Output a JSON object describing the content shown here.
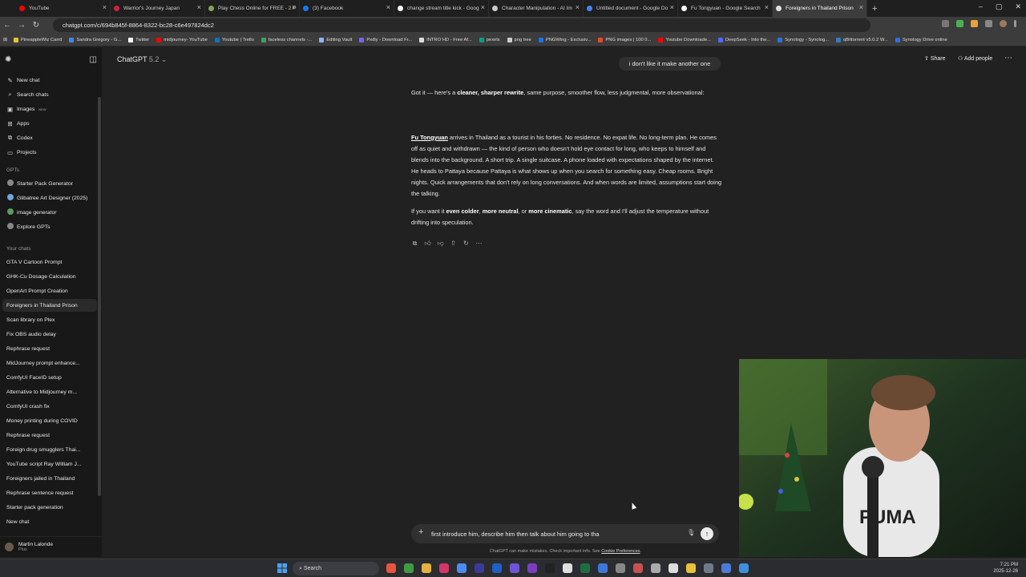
{
  "browser": {
    "tabs": [
      {
        "title": "YouTube",
        "color": "#ff0000",
        "active": false
      },
      {
        "title": "Warrior's Journey Japan",
        "color": "#d21f3c",
        "active": false
      },
      {
        "title": "Play Chess Online for FREE - 2 P",
        "color": "#7fa650",
        "active": false
      },
      {
        "title": "(3) Facebook",
        "color": "#1877f2",
        "active": false
      },
      {
        "title": "change stream title kick - Goog",
        "color": "#ffffff",
        "active": false
      },
      {
        "title": "Character Manipulation - AI Im",
        "color": "#cccccc",
        "active": false
      },
      {
        "title": "Untitled document - Google Do",
        "color": "#4285f4",
        "active": false
      },
      {
        "title": "Fu Tongyuan - Google Search",
        "color": "#ffffff",
        "active": false
      },
      {
        "title": "Foreigners in Thailand Prison",
        "color": "#e0e0e0",
        "active": true
      }
    ],
    "url": "chatgpt.com/c/694b845f-8864-8322-bc28-c6e497824dc2",
    "bookmarks": [
      {
        "label": "PineappleWiz Carrd",
        "color": "#e6c13a"
      },
      {
        "label": "Sandra Gregory - G...",
        "color": "#4285f4"
      },
      {
        "label": "Twitter",
        "color": "#ffffff"
      },
      {
        "label": "midjourney- YouTube",
        "color": "#ff0000"
      },
      {
        "label": "Youtube | Trello",
        "color": "#0079bf"
      },
      {
        "label": "faceless channels -...",
        "color": "#34a853"
      },
      {
        "label": "Editing Vault",
        "color": "#8ab4f8"
      },
      {
        "label": "Pxdly - Download Fr...",
        "color": "#7b61ff"
      },
      {
        "label": "INTRO HD - Free Af...",
        "color": "#dddddd"
      },
      {
        "label": "pexels",
        "color": "#05a081"
      },
      {
        "label": "png tree",
        "color": "#cccccc"
      },
      {
        "label": "PNGWing - Exclusiv...",
        "color": "#1a73e8"
      },
      {
        "label": "PNG images | 100 0...",
        "color": "#e34c26"
      },
      {
        "label": "Youtube Downloade...",
        "color": "#ff0000"
      },
      {
        "label": "DeepSeek - Into the...",
        "color": "#4d6bfe"
      },
      {
        "label": "Synology - Synolog...",
        "color": "#2f6fe0"
      },
      {
        "label": "qBittorrent v5.0.2 W...",
        "color": "#3a79c1"
      },
      {
        "label": "Synology Drive online",
        "color": "#2f6fe0"
      }
    ]
  },
  "sidebar": {
    "primary": [
      {
        "label": "New chat",
        "icon": "✎",
        "iconName": "new-chat-icon"
      },
      {
        "label": "Search chats",
        "icon": "⌕",
        "iconName": "search-icon"
      },
      {
        "label": "Images",
        "icon": "▣",
        "iconName": "images-icon",
        "badge": "NEW"
      },
      {
        "label": "Apps",
        "icon": "⊞",
        "iconName": "apps-icon"
      },
      {
        "label": "Codex",
        "icon": "⧉",
        "iconName": "codex-icon"
      },
      {
        "label": "Projects",
        "icon": "▭",
        "iconName": "projects-icon"
      }
    ],
    "gpts_heading": "GPTs",
    "gpts": [
      {
        "label": "Starter Pack Generator",
        "color": "#8a8a8a"
      },
      {
        "label": "Glibatree Art Designer (2025)",
        "color": "#6fa8dc"
      },
      {
        "label": "image generator",
        "color": "#5c9a5c"
      },
      {
        "label": "Explore GPTs",
        "color": "#888888"
      }
    ],
    "chats_heading": "Your chats",
    "chats": [
      "GTA V Cartoon Prompt",
      "GHK-Cu Dosage Calculation",
      "OpenArt Prompt Creation",
      "Foreigners in Thailand Prison",
      "Scan library on Plex",
      "Fix OBS audio delay",
      "Rephrase request",
      "MidJourney prompt enhance...",
      "ComfyUI FaceID setup",
      "Alternative to Midjourney m...",
      "ComfyUI crash fix",
      "Money printing during COVID",
      "Rephrase request",
      "Foreign drug smugglers Thai...",
      "YouTube script Ray William J...",
      "Foreigners jailed in Thailand",
      "Rephrase sentence request",
      "Starter pack generation",
      "New chat"
    ],
    "active_chat_index": 3,
    "user": {
      "name": "Martin Lalonde",
      "plan": "Plus"
    }
  },
  "header": {
    "model": "ChatGPT",
    "version": "5.2",
    "share": "Share",
    "add_people": "Add people"
  },
  "conversation": {
    "user_message": "i don't like it make another one",
    "p1": {
      "before": "Got it — here's a ",
      "bold": "cleaner, sharper rewrite",
      "after": ", same purpose, smoother flow, less judgmental, more observational:"
    },
    "p2": {
      "name": "Fu Tongyuan",
      "text": " arrives in Thailand as a tourist in his forties. No residence. No expat life. No long-term plan. He comes off as quiet and withdrawn — the kind of person who doesn't hold eye contact for long, who keeps to himself and blends into the background. A short trip. A single suitcase. A phone loaded with expectations shaped by the internet. He heads to Pattaya because Pattaya is what shows up when you search for something easy. Cheap rooms. Bright nights. Quick arrangements that don't rely on long conversations. And when words are limited, assumptions start doing the talking."
    },
    "p3": {
      "a": "If you want it ",
      "b1": "even colder",
      "c": ", ",
      "b2": "more neutral",
      "d": ", or ",
      "b3": "more cinematic",
      "e": ", say the word and I'll adjust the temperature without drifting into speculation."
    }
  },
  "composer": {
    "text": "first introduce him, describe him then talk about him going to tha"
  },
  "disclaimer": {
    "text": "ChatGPT can make mistakes. Check important info. See ",
    "link": "Cookie Preferences",
    "end": "."
  },
  "taskbar": {
    "search": "Search",
    "time": "7:21 PM",
    "date": "2025-12-26",
    "icons": [
      "#e8553d",
      "#3f9b3f",
      "#e3b341",
      "#d4356a",
      "#4c8bf5",
      "#3a3a9a",
      "#1f5fc7",
      "#6e55d8",
      "#7a3fbf",
      "#222222",
      "#e0e0e0",
      "#1d6f42",
      "#3c78d8",
      "#888888",
      "#c85050",
      "#aaaaaa",
      "#dddddd",
      "#e8c33a",
      "#6f7a88",
      "#4b7bd6",
      "#3f8fe0"
    ]
  }
}
